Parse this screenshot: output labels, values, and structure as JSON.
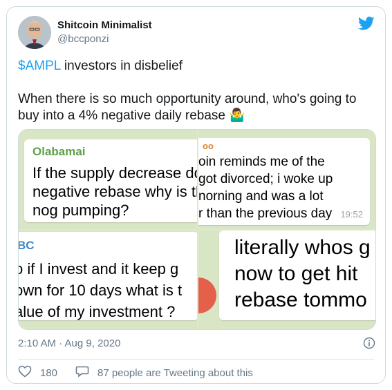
{
  "author": {
    "display_name": "Shitcoin Minimalist",
    "handle": "@bccponzi"
  },
  "tweet": {
    "cashtag": "$AMPL",
    "line1_rest": " investors in disbelief",
    "line2": "When there is so much opportunity around, who's going to buy into a 4% negative daily rebase 🤷‍♂️"
  },
  "media": {
    "top_left": {
      "sender": "Olabamai",
      "lines": [
        "If the supply decrease do",
        "negative rebase why is th",
        "nog pumping?"
      ]
    },
    "top_right": {
      "sender": "oo",
      "lines": [
        "oin reminds me of the",
        "got divorced; i woke up",
        "norning and was a lot",
        "r than the previous day"
      ],
      "time": "19:52"
    },
    "bottom_left": {
      "sender": "BC",
      "lines": [
        "o if I invest and it keep g",
        "own for 10 days what is t",
        "alue of my investment ?"
      ]
    },
    "bottom_right": {
      "lines": [
        "literally whos g",
        "now to get hit",
        "rebase tommo"
      ]
    }
  },
  "meta": {
    "timestamp": "2:10 AM · Aug 9, 2020"
  },
  "stats": {
    "likes": "180",
    "discussion": "87 people are Tweeting about this"
  },
  "icons": {
    "brand": "twitter-bird-icon",
    "info": "info-icon",
    "like": "heart-icon",
    "reply": "speech-bubble-icon"
  },
  "colors": {
    "accent": "#1da1f2",
    "muted": "#657786"
  }
}
